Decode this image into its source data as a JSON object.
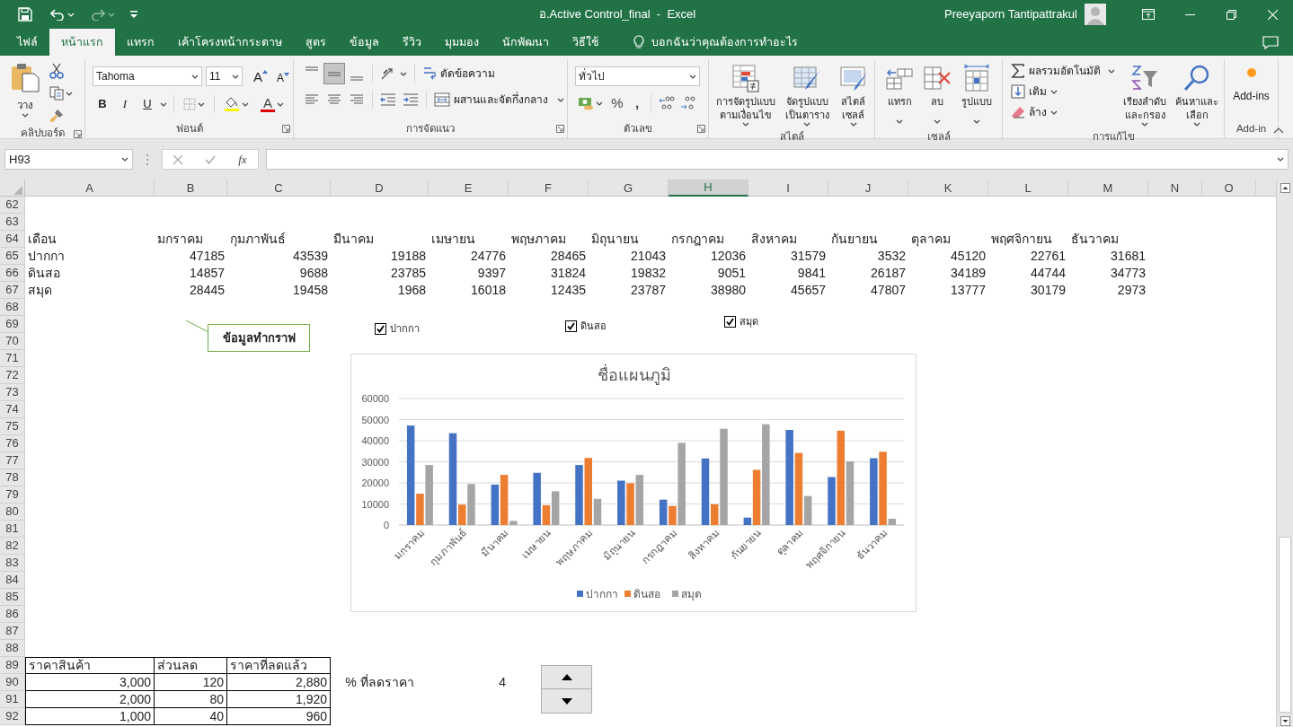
{
  "title_bar": {
    "document_title": "อ.Active Control_final  -  Excel",
    "user": "Preeyaporn Tantipattrakul"
  },
  "tabs": [
    {
      "label": "ไฟล์",
      "selected": false
    },
    {
      "label": "หน้าแรก",
      "selected": true
    },
    {
      "label": "แทรก",
      "selected": false
    },
    {
      "label": "เค้าโครงหน้ากระดาษ",
      "selected": false
    },
    {
      "label": "สูตร",
      "selected": false
    },
    {
      "label": "ข้อมูล",
      "selected": false
    },
    {
      "label": "รีวิว",
      "selected": false
    },
    {
      "label": "มุมมอง",
      "selected": false
    },
    {
      "label": "นักพัฒนา",
      "selected": false
    },
    {
      "label": "วิธีใช้",
      "selected": false
    }
  ],
  "tell_me": "บอกฉันว่าคุณต้องการทำอะไร",
  "ribbon": [
    {
      "kind": "clipboard",
      "label": "คลิปบอร์ด",
      "paste": "วาง"
    },
    {
      "kind": "font",
      "label": "ฟอนต์",
      "font": "Tahoma",
      "size": "11",
      "grow": "A",
      "shrink": "A",
      "bold": "B",
      "italic": "I",
      "underline": "U",
      "font_color": "A"
    },
    {
      "kind": "alignment",
      "label": "การจัดแนว",
      "vertical_align": [
        {
          "selected": false
        },
        {
          "selected": true
        },
        {
          "selected": false
        }
      ],
      "wrap": "ตัดข้อความ",
      "merge": "ผสานและจัดกึ่งกลาง"
    },
    {
      "kind": "number",
      "label": "ตัวเลข",
      "format": "ทั่วไป",
      "percent": "%",
      "comma": ","
    },
    {
      "kind": "styles",
      "label": "สไตล์",
      "buttons": [
        "การจัดรูปแบบ\nตามเงื่อนไข",
        "จัดรูปแบบ\nเป็นตาราง",
        "สไตล์\nเซลล์"
      ]
    },
    {
      "kind": "cells",
      "label": "เซลล์",
      "buttons": [
        "แทรก",
        "ลบ",
        "รูปแบบ"
      ]
    },
    {
      "kind": "editing",
      "label": "การแก้ไข",
      "autosum": "ผลรวมอัตโนมัติ",
      "fill": "เติม",
      "clear": "ล้าง",
      "sort": "เรียงลำดับ\nและกรอง",
      "find": "ค้นหาและ\nเลือก"
    },
    {
      "kind": "addins",
      "label": "Add-in",
      "button": "Add-ins"
    }
  ],
  "formula_bar": {
    "name_box": "H93",
    "function_label": "fx"
  },
  "columns": [
    {
      "label": "A",
      "selected": false
    },
    {
      "label": "B",
      "selected": false
    },
    {
      "label": "C",
      "selected": false
    },
    {
      "label": "D",
      "selected": false
    },
    {
      "label": "E",
      "selected": false
    },
    {
      "label": "F",
      "selected": false
    },
    {
      "label": "G",
      "selected": false
    },
    {
      "label": "H",
      "selected": true
    },
    {
      "label": "I",
      "selected": false
    },
    {
      "label": "J",
      "selected": false
    },
    {
      "label": "K",
      "selected": false
    },
    {
      "label": "L",
      "selected": false
    },
    {
      "label": "M",
      "selected": false
    },
    {
      "label": "N",
      "selected": false
    },
    {
      "label": "O",
      "selected": false
    }
  ],
  "rows": [
    {
      "number": "62"
    },
    {
      "number": "63"
    },
    {
      "number": "64",
      "cells": [
        {
          "text": "เดือน",
          "kind": "text",
          "bordered": false
        },
        {
          "text": "มกราคม",
          "kind": "text",
          "bordered": false
        },
        {
          "text": "กุมภาพันธ์",
          "kind": "text",
          "bordered": false
        },
        {
          "text": "มีนาคม",
          "kind": "text",
          "bordered": false
        },
        {
          "text": "เมษายน",
          "kind": "text",
          "bordered": false
        },
        {
          "text": "พฤษภาคม",
          "kind": "text",
          "bordered": false
        },
        {
          "text": "มิถุนายน",
          "kind": "text",
          "bordered": false
        },
        {
          "text": "กรกฎาคม",
          "kind": "text",
          "bordered": false
        },
        {
          "text": "สิงหาคม",
          "kind": "text",
          "bordered": false
        },
        {
          "text": "กันยายน",
          "kind": "text",
          "bordered": false
        },
        {
          "text": "ตุลาคม",
          "kind": "text",
          "bordered": false
        },
        {
          "text": "พฤศจิกายน",
          "kind": "text",
          "bordered": false
        },
        {
          "text": "ธันวาคม",
          "kind": "text",
          "bordered": false
        }
      ]
    },
    {
      "number": "65",
      "cells": [
        {
          "text": "ปากกา",
          "kind": "text",
          "bordered": false
        },
        {
          "text": "47185",
          "kind": "number",
          "bordered": false
        },
        {
          "text": "43539",
          "kind": "number",
          "bordered": false
        },
        {
          "text": "19188",
          "kind": "number",
          "bordered": false
        },
        {
          "text": "24776",
          "kind": "number",
          "bordered": false
        },
        {
          "text": "28465",
          "kind": "number",
          "bordered": false
        },
        {
          "text": "21043",
          "kind": "number",
          "bordered": false
        },
        {
          "text": "12036",
          "kind": "number",
          "bordered": false
        },
        {
          "text": "31579",
          "kind": "number",
          "bordered": false
        },
        {
          "text": "3532",
          "kind": "number",
          "bordered": false
        },
        {
          "text": "45120",
          "kind": "number",
          "bordered": false
        },
        {
          "text": "22761",
          "kind": "number",
          "bordered": false
        },
        {
          "text": "31681",
          "kind": "number",
          "bordered": false
        }
      ]
    },
    {
      "number": "66",
      "cells": [
        {
          "text": "ดินสอ",
          "kind": "text",
          "bordered": false
        },
        {
          "text": "14857",
          "kind": "number",
          "bordered": false
        },
        {
          "text": "9688",
          "kind": "number",
          "bordered": false
        },
        {
          "text": "23785",
          "kind": "number",
          "bordered": false
        },
        {
          "text": "9397",
          "kind": "number",
          "bordered": false
        },
        {
          "text": "31824",
          "kind": "number",
          "bordered": false
        },
        {
          "text": "19832",
          "kind": "number",
          "bordered": false
        },
        {
          "text": "9051",
          "kind": "number",
          "bordered": false
        },
        {
          "text": "9841",
          "kind": "number",
          "bordered": false
        },
        {
          "text": "26187",
          "kind": "number",
          "bordered": false
        },
        {
          "text": "34189",
          "kind": "number",
          "bordered": false
        },
        {
          "text": "44744",
          "kind": "number",
          "bordered": false
        },
        {
          "text": "34773",
          "kind": "number",
          "bordered": false
        }
      ]
    },
    {
      "number": "67",
      "cells": [
        {
          "text": "สมุด",
          "kind": "text",
          "bordered": false
        },
        {
          "text": "28445",
          "kind": "number",
          "bordered": false
        },
        {
          "text": "19458",
          "kind": "number",
          "bordered": false
        },
        {
          "text": "1968",
          "kind": "number",
          "bordered": false
        },
        {
          "text": "16018",
          "kind": "number",
          "bordered": false
        },
        {
          "text": "12435",
          "kind": "number",
          "bordered": false
        },
        {
          "text": "23787",
          "kind": "number",
          "bordered": false
        },
        {
          "text": "38980",
          "kind": "number",
          "bordered": false
        },
        {
          "text": "45657",
          "kind": "number",
          "bordered": false
        },
        {
          "text": "47807",
          "kind": "number",
          "bordered": false
        },
        {
          "text": "13777",
          "kind": "number",
          "bordered": false
        },
        {
          "text": "30179",
          "kind": "number",
          "bordered": false
        },
        {
          "text": "2973",
          "kind": "number",
          "bordered": false
        }
      ]
    },
    {
      "number": "68"
    },
    {
      "number": "69"
    },
    {
      "number": "70"
    },
    {
      "number": "71"
    },
    {
      "number": "72"
    },
    {
      "number": "73"
    },
    {
      "number": "74"
    },
    {
      "number": "75"
    },
    {
      "number": "76"
    },
    {
      "number": "77"
    },
    {
      "number": "78"
    },
    {
      "number": "79"
    },
    {
      "number": "80"
    },
    {
      "number": "81"
    },
    {
      "number": "82"
    },
    {
      "number": "83"
    },
    {
      "number": "84"
    },
    {
      "number": "85"
    },
    {
      "number": "86"
    },
    {
      "number": "87"
    },
    {
      "number": "88"
    },
    {
      "number": "89",
      "cells": [
        {
          "text": "ราคาสินค้า",
          "kind": "text",
          "bordered": true
        },
        {
          "text": "ส่วนลด",
          "kind": "text",
          "bordered": true
        },
        {
          "text": "ราคาที่ลดแล้ว",
          "kind": "text",
          "bordered": true
        }
      ]
    },
    {
      "number": "90",
      "cells": [
        {
          "text": "3,000",
          "kind": "number",
          "bordered": true
        },
        {
          "text": "120",
          "kind": "number",
          "bordered": true
        },
        {
          "text": "2,880",
          "kind": "number",
          "bordered": true
        },
        {
          "text": "% ที่ลดราคา",
          "kind": "label",
          "bordered": false
        },
        {
          "text": "4",
          "kind": "number",
          "bordered": false
        }
      ]
    },
    {
      "number": "91",
      "cells": [
        {
          "text": "2,000",
          "kind": "number",
          "bordered": true
        },
        {
          "text": "80",
          "kind": "number",
          "bordered": true
        },
        {
          "text": "1,920",
          "kind": "number",
          "bordered": true
        }
      ]
    },
    {
      "number": "92",
      "cells": [
        {
          "text": "1,000",
          "kind": "number",
          "bordered": true
        },
        {
          "text": "40",
          "kind": "number",
          "bordered": true
        },
        {
          "text": "960",
          "kind": "number",
          "bordered": true
        }
      ]
    }
  ],
  "callout": {
    "text": "ข้อมูลทำกราฟ"
  },
  "checkboxes": [
    {
      "label": "ปากกา",
      "checked": true
    },
    {
      "label": "ดินสอ",
      "checked": true
    },
    {
      "label": "สมุด",
      "checked": true
    }
  ],
  "chart": {
    "chart_data": {
      "type": "bar",
      "title": "ชื่อแผนภูมิ",
      "grid": true,
      "legend": true,
      "categories": [
        "มกราคม",
        "กุมภาพันธ์",
        "มีนาคม",
        "เมษายน",
        "พฤษภาคม",
        "มิถุนายน",
        "กรกฎาคม",
        "สิงหาคม",
        "กันยายน",
        "ตุลาคม",
        "พฤศจิกายน",
        "ธันวาคม"
      ],
      "series": [
        {
          "name": "ปากกา",
          "color": "#4472c4",
          "values": [
            47185,
            43539,
            19188,
            24776,
            28465,
            21043,
            12036,
            31579,
            3532,
            45120,
            22761,
            31681
          ]
        },
        {
          "name": "ดินสอ",
          "color": "#ed7d31",
          "values": [
            14857,
            9688,
            23785,
            9397,
            31824,
            19832,
            9051,
            9841,
            26187,
            34189,
            44744,
            34773
          ]
        },
        {
          "name": "สมุด",
          "color": "#a5a5a5",
          "values": [
            28445,
            19458,
            1968,
            16018,
            12435,
            23787,
            38980,
            45657,
            47807,
            13777,
            30179,
            2973
          ]
        }
      ],
      "ylim": [
        0,
        60000
      ],
      "yticks": [
        0,
        10000,
        20000,
        30000,
        40000,
        50000,
        60000
      ]
    }
  }
}
